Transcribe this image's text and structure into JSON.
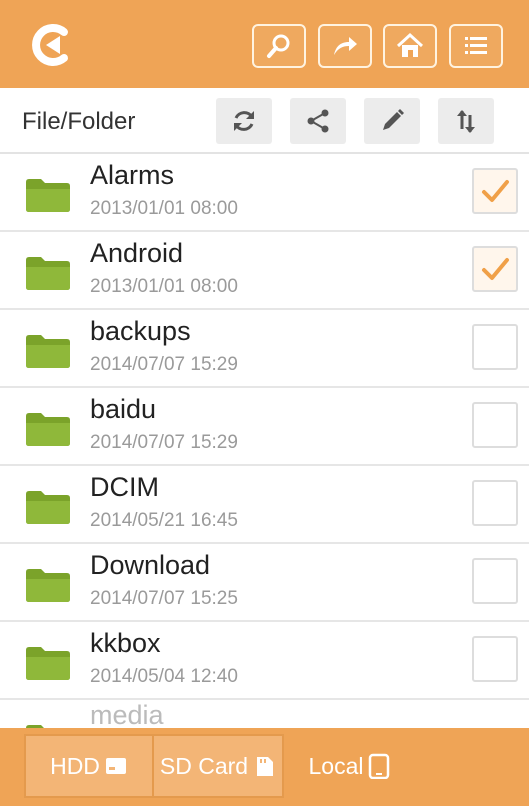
{
  "header": {
    "app_logo_icon": "app-logo-icon",
    "buttons": [
      {
        "icon": "search-icon"
      },
      {
        "icon": "share-forward-icon"
      },
      {
        "icon": "home-icon"
      },
      {
        "icon": "menu-icon"
      }
    ]
  },
  "toolbar": {
    "label": "File/Folder",
    "buttons": [
      {
        "icon": "refresh-icon"
      },
      {
        "icon": "share-icon"
      },
      {
        "icon": "edit-pencil-icon"
      },
      {
        "icon": "sort-icon"
      }
    ]
  },
  "files": [
    {
      "name": "Alarms",
      "date": "2013/01/01 08:00",
      "checked": true
    },
    {
      "name": "Android",
      "date": "2013/01/01 08:00",
      "checked": true
    },
    {
      "name": "backups",
      "date": "2014/07/07 15:29",
      "checked": false
    },
    {
      "name": "baidu",
      "date": "2014/07/07 15:29",
      "checked": false
    },
    {
      "name": "DCIM",
      "date": "2014/05/21 16:45",
      "checked": false
    },
    {
      "name": "Download",
      "date": "2014/07/07 15:25",
      "checked": false
    },
    {
      "name": "kkbox",
      "date": "2014/05/04 12:40",
      "checked": false
    },
    {
      "name": "media",
      "date": "",
      "checked": false
    }
  ],
  "bottom_tabs": [
    {
      "label": "HDD",
      "icon": "hdd-icon",
      "active": false
    },
    {
      "label": "SD Card",
      "icon": "sd-card-icon",
      "active": false
    },
    {
      "label": "Local",
      "icon": "phone-icon",
      "active": true
    }
  ],
  "colors": {
    "accent": "#efa456",
    "folder": "#7ba32a",
    "check": "#f0a048"
  }
}
